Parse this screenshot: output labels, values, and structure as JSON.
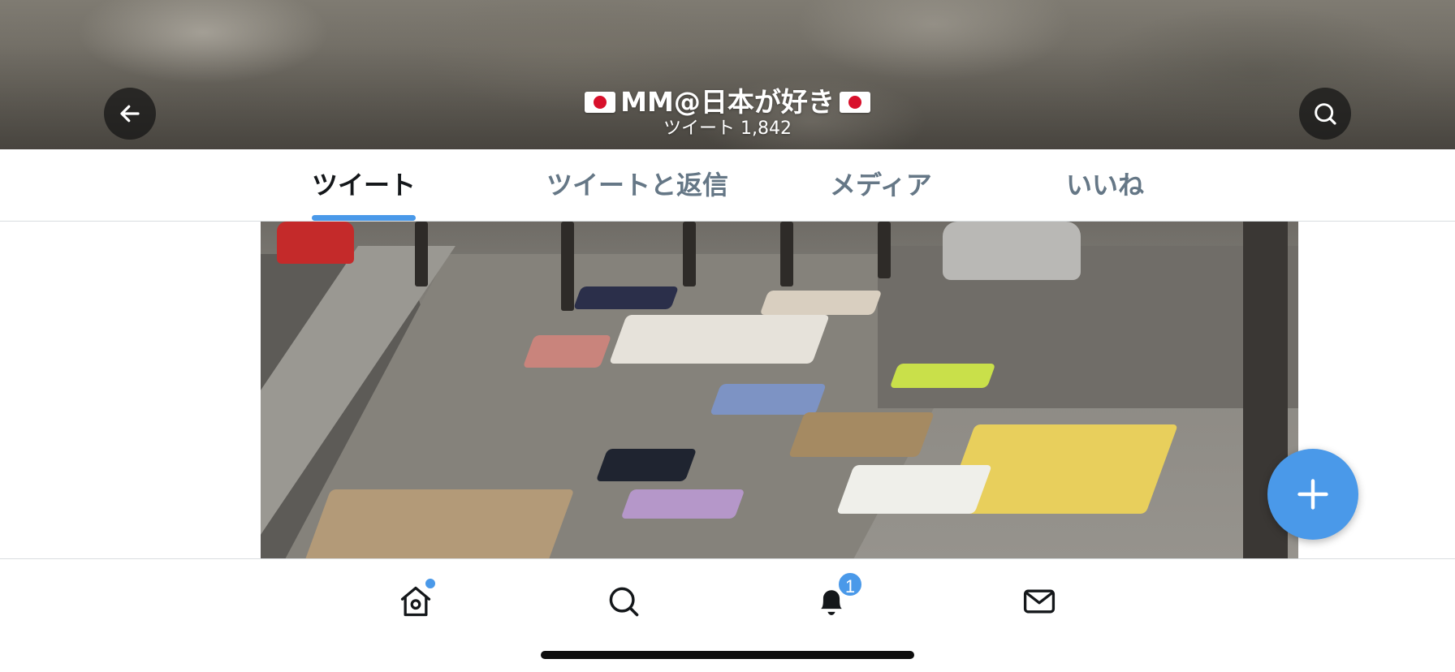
{
  "header": {
    "display_name": "MM@日本が好き",
    "tweet_count": "ツイート 1,842",
    "flag_icon": "japan-flag-icon",
    "back_icon": "arrow-left-icon",
    "search_icon": "search-icon"
  },
  "tabs": [
    {
      "label": "ツイート",
      "active": true
    },
    {
      "label": "ツイートと返信",
      "active": false
    },
    {
      "label": "メディア",
      "active": false
    },
    {
      "label": "いいね",
      "active": false
    }
  ],
  "compose": {
    "icon": "plus-icon"
  },
  "tabbar": {
    "items": [
      {
        "name": "home",
        "icon": "home-icon",
        "has_dot": true
      },
      {
        "name": "search",
        "icon": "search-icon"
      },
      {
        "name": "notifications",
        "icon": "bell-icon",
        "badge": "1"
      },
      {
        "name": "messages",
        "icon": "mail-icon"
      }
    ]
  },
  "colors": {
    "accent": "#4a99e9",
    "text_primary": "#14171a",
    "text_secondary": "#657786"
  }
}
